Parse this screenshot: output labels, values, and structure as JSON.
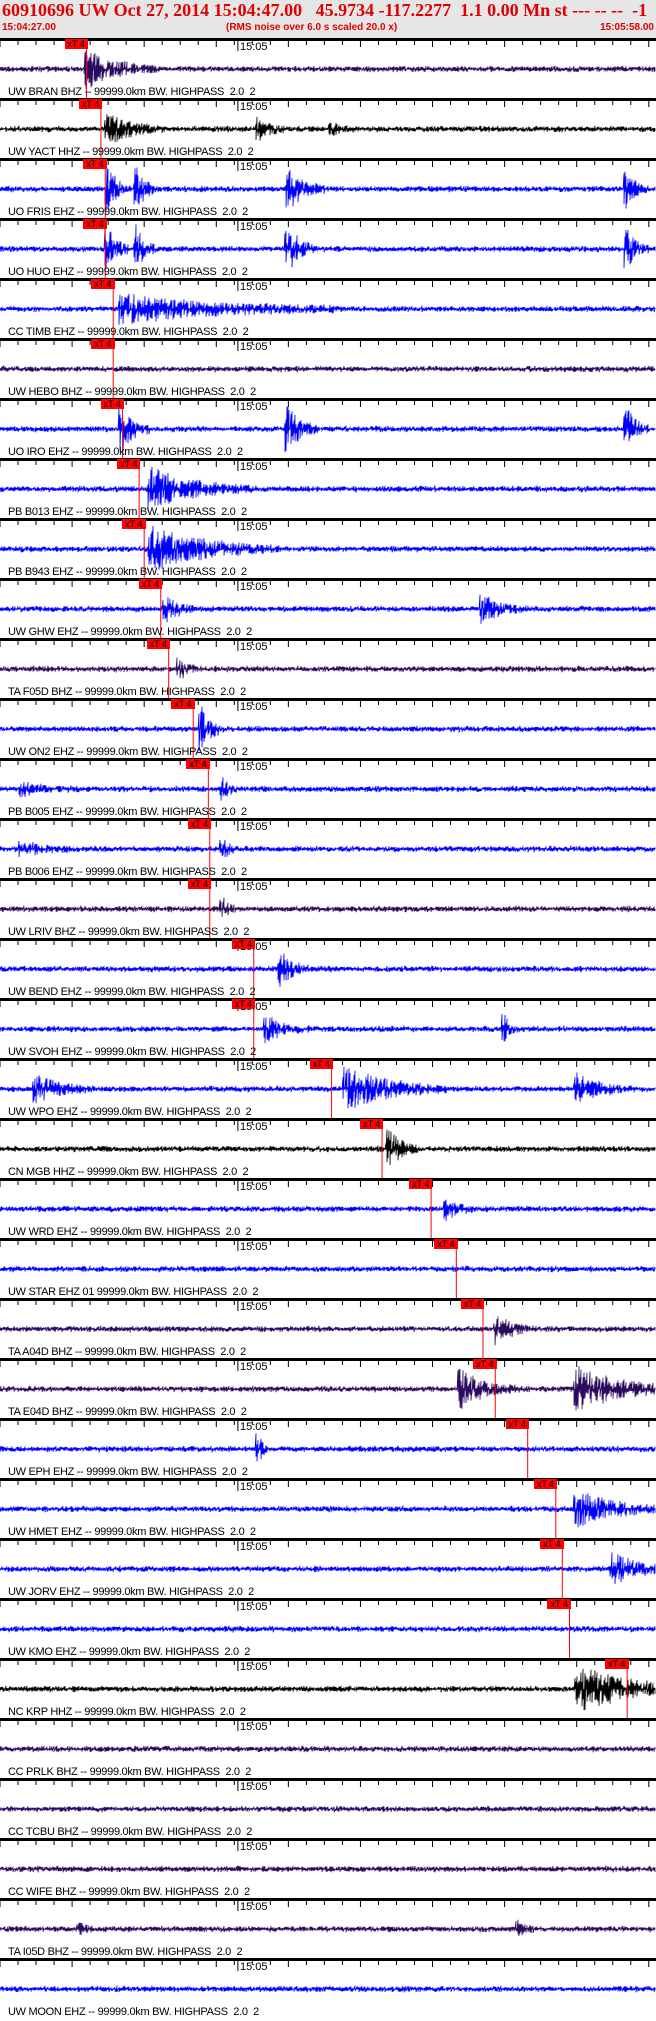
{
  "header": {
    "title": "60910696 UW Oct 27, 2014 15:04:47.00   45.9734 -117.2277  1.1 0.00 Mn st --- -- --  -1",
    "start_time": "15:04:27.00",
    "note": "(RMS noise over 6.0 s scaled 20.0 x)",
    "end_time": "15:05:58.00",
    "minute_label": "15:05",
    "duration_s": 91,
    "minute_offset_s": 33
  },
  "pick_label": "xT 4",
  "colors": {
    "purple": "#2a0a5e",
    "blue": "#0000ff",
    "black": "#000000",
    "pick": "#ff0000"
  },
  "traces": [
    {
      "label": "UW BRAN BHZ -- 99999.0km BW. HIGHPASS  2.0  2",
      "color": "purple",
      "pick": 12,
      "bursts": [
        [
          12,
          18,
          10
        ]
      ]
    },
    {
      "label": "UW YACT HHZ -- 99999.0km BW. HIGHPASS  2.0  2",
      "color": "black",
      "pick": 14,
      "bursts": [
        [
          15,
          14,
          8
        ],
        [
          36,
          10,
          4
        ],
        [
          46,
          6,
          3
        ]
      ]
    },
    {
      "label": "UO FRIS EHZ -- 99999.0km BW. HIGHPASS  2.0  2",
      "color": "blue",
      "pick": 14.6,
      "bursts": [
        [
          15,
          22,
          3
        ],
        [
          19,
          22,
          3
        ],
        [
          40,
          22,
          5
        ],
        [
          87,
          18,
          3
        ]
      ]
    },
    {
      "label": "UO HUO EHZ -- 99999.0km BW. HIGHPASS  2.0  2",
      "color": "blue",
      "pick": 14.6,
      "bursts": [
        [
          15,
          22,
          3
        ],
        [
          19,
          22,
          3
        ],
        [
          40,
          22,
          4
        ],
        [
          87,
          18,
          3
        ]
      ]
    },
    {
      "label": "CC TIMB EHZ -- 99999.0km BW. HIGHPASS  2.0  2",
      "color": "blue",
      "pick": 15.7,
      "bursts": [
        [
          17,
          14,
          30
        ]
      ]
    },
    {
      "label": "UW HEBO BHZ -- 99999.0km BW. HIGHPASS  2.0  2",
      "color": "purple",
      "pick": 15.7,
      "bursts": []
    },
    {
      "label": "UO IRO EHZ -- 99999.0km BW. HIGHPASS  2.0  2",
      "color": "blue",
      "pick": 17,
      "bursts": [
        [
          17,
          22,
          4
        ],
        [
          40,
          22,
          4
        ],
        [
          87,
          22,
          3
        ]
      ]
    },
    {
      "label": "PB B013 EHZ -- 99999.0km BW. HIGHPASS  2.0  2",
      "color": "blue",
      "pick": 19.3,
      "bursts": [
        [
          21,
          20,
          14
        ]
      ]
    },
    {
      "label": "PB B943 EHZ -- 99999.0km BW. HIGHPASS  2.0  2",
      "color": "blue",
      "pick": 20,
      "bursts": [
        [
          21,
          22,
          18
        ]
      ]
    },
    {
      "label": "UW GHW EHZ -- 99999.0km BW. HIGHPASS  2.0  2",
      "color": "blue",
      "pick": 22.3,
      "bursts": [
        [
          23,
          14,
          4
        ],
        [
          67,
          14,
          6
        ]
      ]
    },
    {
      "label": "TA F05D BHZ -- 99999.0km BW. HIGHPASS  2.0  2",
      "color": "purple",
      "pick": 23.4,
      "bursts": [
        [
          25,
          10,
          3
        ]
      ]
    },
    {
      "label": "UW ON2 EHZ -- 99999.0km BW. HIGHPASS  2.0  2",
      "color": "blue",
      "pick": 26.8,
      "bursts": [
        [
          28,
          22,
          3
        ]
      ]
    },
    {
      "label": "PB B005 EHZ -- 99999.0km BW. HIGHPASS  2.0  2",
      "color": "blue",
      "pick": 28.9,
      "bursts": [
        [
          3,
          6,
          8
        ],
        [
          31,
          10,
          2
        ]
      ]
    },
    {
      "label": "PB B006 EHZ -- 99999.0km BW. HIGHPASS  2.0  2",
      "color": "blue",
      "pick": 29.1,
      "bursts": [
        [
          3,
          6,
          8
        ],
        [
          31,
          10,
          2
        ]
      ]
    },
    {
      "label": "UW LRIV BHZ -- 99999.0km BW. HIGHPASS  2.0  2",
      "color": "purple",
      "pick": 29.1,
      "bursts": [
        [
          31,
          10,
          2
        ]
      ]
    },
    {
      "label": "UW BEND EHZ -- 99999.0km BW. HIGHPASS  2.0  2",
      "color": "blue",
      "pick": 35.2,
      "bursts": [
        [
          39,
          16,
          4
        ]
      ]
    },
    {
      "label": "UW SVOH EHZ -- 99999.0km BW. HIGHPASS  2.0  2",
      "color": "blue",
      "pick": 35.2,
      "bursts": [
        [
          37,
          12,
          6
        ],
        [
          70,
          14,
          2
        ]
      ]
    },
    {
      "label": "UW WPO EHZ -- 99999.0km BW. HIGHPASS  2.0  2",
      "color": "blue",
      "pick": 46,
      "bursts": [
        [
          5,
          14,
          8
        ],
        [
          48,
          22,
          14
        ],
        [
          80,
          14,
          8
        ]
      ]
    },
    {
      "label": "CN MGB HHZ -- 99999.0km BW. HIGHPASS  2.0  2",
      "color": "black",
      "pick": 53,
      "bursts": [
        [
          54,
          20,
          4
        ]
      ]
    },
    {
      "label": "UW WRD EHZ -- 99999.0km BW. HIGHPASS  2.0  2",
      "color": "blue",
      "pick": 59.8,
      "bursts": [
        [
          62,
          10,
          4
        ]
      ]
    },
    {
      "label": "UW STAR EHZ 01 99999.0km BW. HIGHPASS  2.0  2",
      "color": "blue",
      "pick": 63.3,
      "bursts": []
    },
    {
      "label": "TA A04D BHZ -- 99999.0km BW. HIGHPASS  2.0  2",
      "color": "purple",
      "pick": 67,
      "bursts": [
        [
          69,
          14,
          5
        ]
      ]
    },
    {
      "label": "TA E04D BHZ -- 99999.0km BW. HIGHPASS  2.0  2",
      "color": "purple",
      "pick": 68.7,
      "bursts": [
        [
          64,
          18,
          8
        ],
        [
          80,
          22,
          14
        ]
      ]
    },
    {
      "label": "UW EPH EHZ -- 99999.0km BW. HIGHPASS  2.0  2",
      "color": "blue",
      "pick": 73.2,
      "bursts": [
        [
          36,
          14,
          1
        ]
      ]
    },
    {
      "label": "UW HMET EHZ -- 99999.0km BW. HIGHPASS  2.0  2",
      "color": "blue",
      "pick": 77.1,
      "bursts": [
        [
          80,
          18,
          12
        ]
      ]
    },
    {
      "label": "UW JORV EHZ -- 99999.0km BW. HIGHPASS  2.0  2",
      "color": "blue",
      "pick": 78,
      "bursts": [
        [
          85,
          16,
          8
        ]
      ]
    },
    {
      "label": "UW KMO EHZ -- 99999.0km BW. HIGHPASS  2.0  2",
      "color": "blue",
      "pick": 79,
      "bursts": []
    },
    {
      "label": "NC KRP HHZ -- 99999.0km BW. HIGHPASS  2.0  2",
      "color": "black",
      "pick": 87,
      "bursts": [
        [
          80,
          24,
          16
        ]
      ]
    },
    {
      "label": "CC PRLK BHZ -- 99999.0km BW. HIGHPASS  2.0  2",
      "color": "purple",
      "pick": null,
      "bursts": []
    },
    {
      "label": "CC TCBU BHZ -- 99999.0km BW. HIGHPASS  2.0  2",
      "color": "purple",
      "pick": null,
      "bursts": []
    },
    {
      "label": "CC WIFE BHZ -- 99999.0km BW. HIGHPASS  2.0  2",
      "color": "purple",
      "pick": null,
      "bursts": []
    },
    {
      "label": "TA I05D BHZ -- 99999.0km BW. HIGHPASS  2.0  2",
      "color": "purple",
      "pick": null,
      "bursts": [
        [
          11,
          6,
          2
        ],
        [
          72,
          8,
          2
        ]
      ]
    },
    {
      "label": "UW MOON EHZ -- 99999.0km BW. HIGHPASS  2.0  2",
      "color": "blue",
      "pick": null,
      "bursts": []
    }
  ]
}
